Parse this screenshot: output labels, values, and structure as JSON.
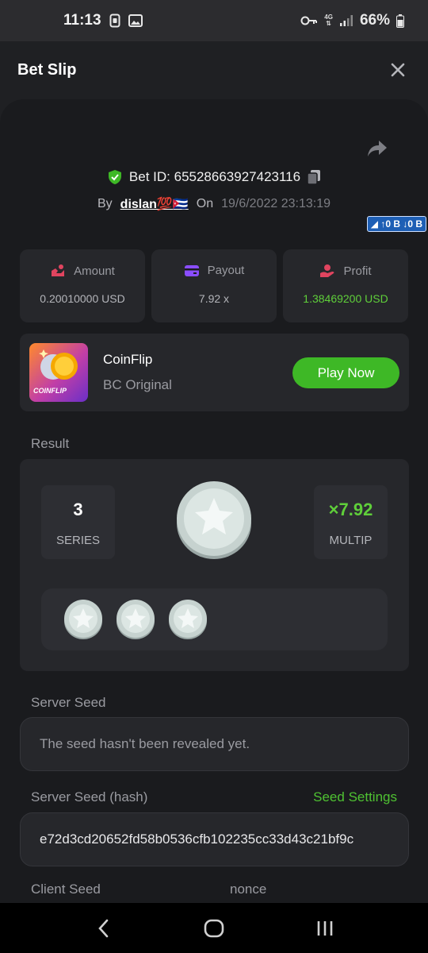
{
  "status_bar": {
    "time": "11:13",
    "battery": "66%",
    "network": "4G"
  },
  "header": {
    "title": "Bet Slip"
  },
  "bet": {
    "id_text": "Bet ID: 65528663927423116",
    "by_label": "By",
    "user": "dislan💯🇨🇺",
    "on_label": "On",
    "date": "19/6/2022 23:13:19",
    "net_badge": "◢ ↑0 B ↓0 B"
  },
  "stats": [
    {
      "label": "Amount",
      "value": "0.20010000 USD"
    },
    {
      "label": "Payout",
      "value": "7.92 x"
    },
    {
      "label": "Profit",
      "value": "1.38469200 USD"
    }
  ],
  "game": {
    "name": "CoinFlip",
    "subtitle": "BC Original",
    "thumb_text": "COINFLIP",
    "play_label": "Play Now"
  },
  "result": {
    "label": "Result",
    "series_value": "3",
    "series_label": "SERIES",
    "multiplier_value": "×7.92",
    "multiplier_label": "MULTIP"
  },
  "seeds": {
    "server_label": "Server Seed",
    "server_placeholder": "The seed hasn't been revealed yet.",
    "hash_label": "Server Seed (hash)",
    "settings_label": "Seed Settings",
    "hash_value": "e72d3cd20652fd58b0536cfb102235cc33d43c21bf9c",
    "client_label": "Client Seed",
    "nonce_label": "nonce"
  },
  "colors": {
    "accent_green": "#3eb826",
    "panel": "#26272b",
    "background": "#1a1b1e"
  }
}
